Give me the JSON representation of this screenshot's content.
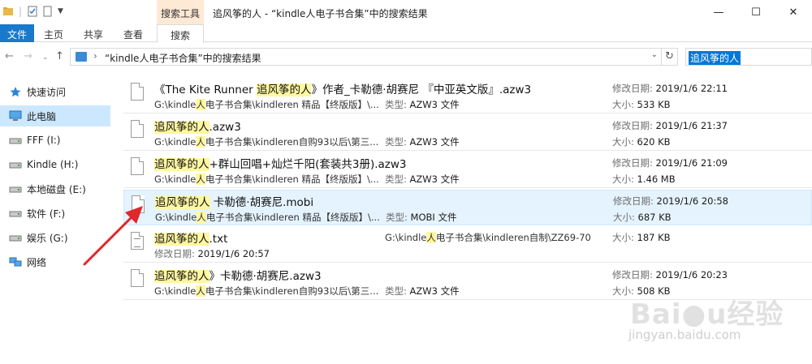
{
  "window": {
    "title": "追风筝的人 - “kindle人电子书合集”中的搜索结果",
    "context_tab": "搜索工具",
    "buttons": {
      "minimize": "—",
      "maximize": "☐",
      "close": "✕"
    }
  },
  "ribbon": {
    "tabs": [
      "文件",
      "主页",
      "共享",
      "查看",
      "搜索"
    ]
  },
  "address": {
    "separator": "›",
    "path": "“kindle人电子书合集”中的搜索结果",
    "search_value": "追风筝的人"
  },
  "sidebar": {
    "items": [
      {
        "label": "快速访问",
        "icon": "star-icon"
      },
      {
        "label": "此电脑",
        "icon": "computer-icon"
      },
      {
        "label": "FFF (I:)",
        "icon": "drive-icon"
      },
      {
        "label": "Kindle (H:)",
        "icon": "drive-icon"
      },
      {
        "label": "本地磁盘 (E:)",
        "icon": "drive-icon"
      },
      {
        "label": "软件 (F:)",
        "icon": "drive-icon"
      },
      {
        "label": "娱乐 (G:)",
        "icon": "drive-icon"
      },
      {
        "label": "网络",
        "icon": "network-icon"
      }
    ]
  },
  "labels": {
    "date": "修改日期:",
    "size": "大小:",
    "type": "类型:"
  },
  "results": [
    {
      "pre": "《The Kite Runner ",
      "hl": "追风筝的人",
      "post": "》作者_卡勒德·胡赛尼 『中亚英文版』.azw3",
      "path_pre": "G:\\kindle",
      "path_hl": "人",
      "path_post": "电子书合集\\kindleren 精品【终版版】\\...",
      "type": "AZW3 文件",
      "date": "2019/1/6 22:11",
      "size": "533 KB"
    },
    {
      "pre": "",
      "hl": "追风筝的人",
      "post": ".azw3",
      "path_pre": "G:\\kindle",
      "path_hl": "人",
      "path_post": "电子书合集\\kindleren自购93以后\\第三...",
      "type": "AZW3 文件",
      "date": "2019/1/6 21:37",
      "size": "620 KB"
    },
    {
      "pre": "",
      "hl": "追风筝的人",
      "post": "+群山回唱+灿烂千阳(套装共3册).azw3",
      "path_pre": "G:\\kindle",
      "path_hl": "人",
      "path_post": "电子书合集\\kindleren 精品【终版版】\\...",
      "type": "AZW3 文件",
      "date": "2019/1/6 21:09",
      "size": "1.46 MB"
    },
    {
      "pre": "",
      "hl": "追风筝的人",
      "post": " 卡勒德·胡赛尼.mobi",
      "path_pre": "G:\\kindle",
      "path_hl": "人",
      "path_post": "电子书合集\\kindleren 精品【终版版】\\...",
      "type": "MOBI 文件",
      "date": "2019/1/6 20:58",
      "size": "687 KB"
    },
    {
      "pre": "",
      "hl": "追风筝的人",
      "post": ".txt",
      "path_pre": "G:\\kindle",
      "path_hl": "人",
      "path_post": "电子书合集\\kindleren自制\\ZZ69-70",
      "date": "2019/1/6 20:57",
      "size": "187 KB"
    },
    {
      "pre": "",
      "hl": "追风筝的人",
      "post": "》卡勒德·胡赛尼.azw3",
      "path_pre": "G:\\kindle",
      "path_hl": "人",
      "path_post": "电子书合集\\kindleren自购93以后\\第三...",
      "type": "AZW3 文件",
      "date": "2019/1/6 20:23",
      "size": "508 KB"
    }
  ],
  "watermark": {
    "brand": "Bai●u经验",
    "url": "jingyan.baidu.com"
  },
  "colors": {
    "accent": "#1979ca",
    "highlight": "#fff7a1",
    "selection": "#cce8ff",
    "arrow": "#e0272b"
  }
}
